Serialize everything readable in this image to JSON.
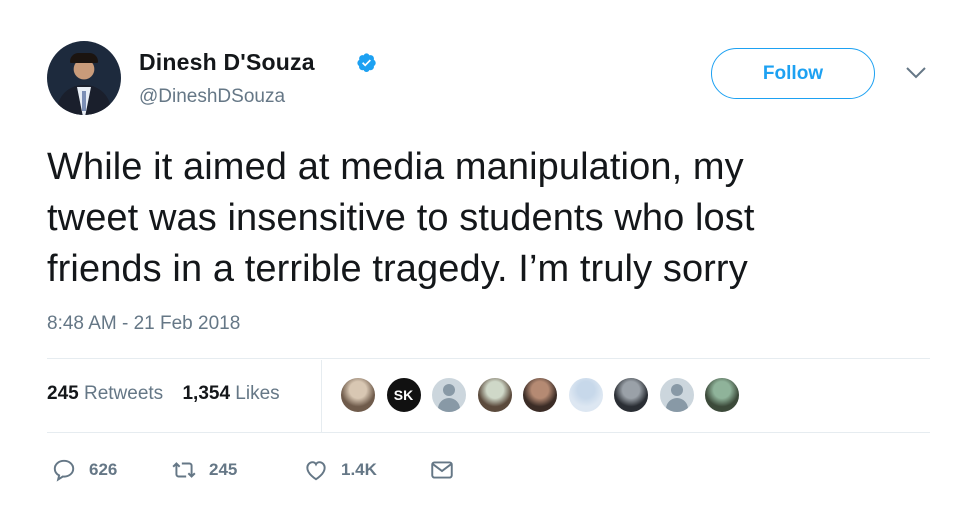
{
  "author": {
    "name": "Dinesh D'Souza",
    "handle": "@DineshDSouza",
    "verified": true
  },
  "follow_button": {
    "label": "Follow"
  },
  "tweet": {
    "text_lines": [
      "While it aimed at media manipulation, my",
      "tweet was insensitive to students who lost",
      "friends in a terrible tragedy. I’m truly sorry"
    ],
    "timestamp": "8:48 AM - 21 Feb 2018"
  },
  "stats": {
    "retweets_count": "245",
    "retweets_label": "Retweets",
    "likes_count": "1,354",
    "likes_label": "Likes"
  },
  "likers": [
    {
      "type": "photo",
      "colors": [
        "#d8c7b3",
        "#6f5b4b"
      ]
    },
    {
      "type": "logo",
      "text": "SK"
    },
    {
      "type": "default"
    },
    {
      "type": "photo",
      "colors": [
        "#cfd8c8",
        "#5b4a3c"
      ]
    },
    {
      "type": "photo",
      "colors": [
        "#b58a73",
        "#3b2c26"
      ]
    },
    {
      "type": "photo",
      "colors": [
        "#c7d8ea",
        "#dde7f2"
      ]
    },
    {
      "type": "photo",
      "colors": [
        "#9aa1a8",
        "#2a2e34"
      ]
    },
    {
      "type": "default"
    },
    {
      "type": "photo",
      "colors": [
        "#8fb39a",
        "#3c4a3a"
      ]
    }
  ],
  "actions": {
    "replies": "626",
    "retweets": "245",
    "likes": "1.4K"
  },
  "colors": {
    "accent": "#1da1f2",
    "text": "#14171a",
    "secondary": "#657786",
    "divider": "#e6ecf0"
  },
  "icons": [
    "verified-badge-icon",
    "chevron-down-icon",
    "reply-icon",
    "retweet-icon",
    "like-icon",
    "message-icon"
  ]
}
